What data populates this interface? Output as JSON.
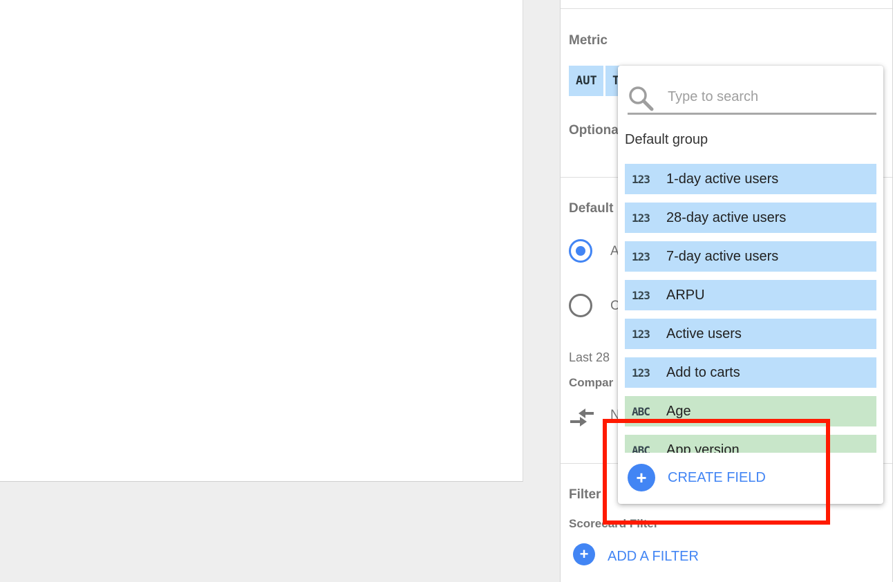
{
  "panel": {
    "metric_label": "Metric",
    "metric_chip_1": "AUT",
    "metric_chip_2": "T",
    "optional_label": "Optiona",
    "default_label": "Default",
    "radio_1_label": "A",
    "radio_2_label": "C",
    "last_text": "Last 28",
    "compare_label": "Compar",
    "compare_text": "N",
    "filter_label": "Filter",
    "scorecard_filter_label": "Scorecard Filter",
    "add_filter_label": "ADD A FILTER"
  },
  "dropdown": {
    "search_placeholder": "Type to search",
    "search_value": "",
    "group_label": "Default group",
    "items": [
      {
        "type": "number",
        "icon": "123",
        "label": "1-day active users"
      },
      {
        "type": "number",
        "icon": "123",
        "label": "28-day active users"
      },
      {
        "type": "number",
        "icon": "123",
        "label": "7-day active users"
      },
      {
        "type": "number",
        "icon": "123",
        "label": "ARPU"
      },
      {
        "type": "number",
        "icon": "123",
        "label": "Active users"
      },
      {
        "type": "number",
        "icon": "123",
        "label": "Add to carts"
      },
      {
        "type": "text",
        "icon": "ABC",
        "label": "Age"
      },
      {
        "type": "text",
        "icon": "ABC",
        "label": "App version"
      }
    ],
    "create_field_label": "CREATE FIELD"
  },
  "colors": {
    "accent": "#4285f4",
    "number_field": "#bbdefb",
    "text_field": "#c8e6c9",
    "highlight": "#ff1a00"
  },
  "icons": {
    "search": "search-icon",
    "compare": "compare-arrows-icon",
    "add": "plus-icon"
  }
}
